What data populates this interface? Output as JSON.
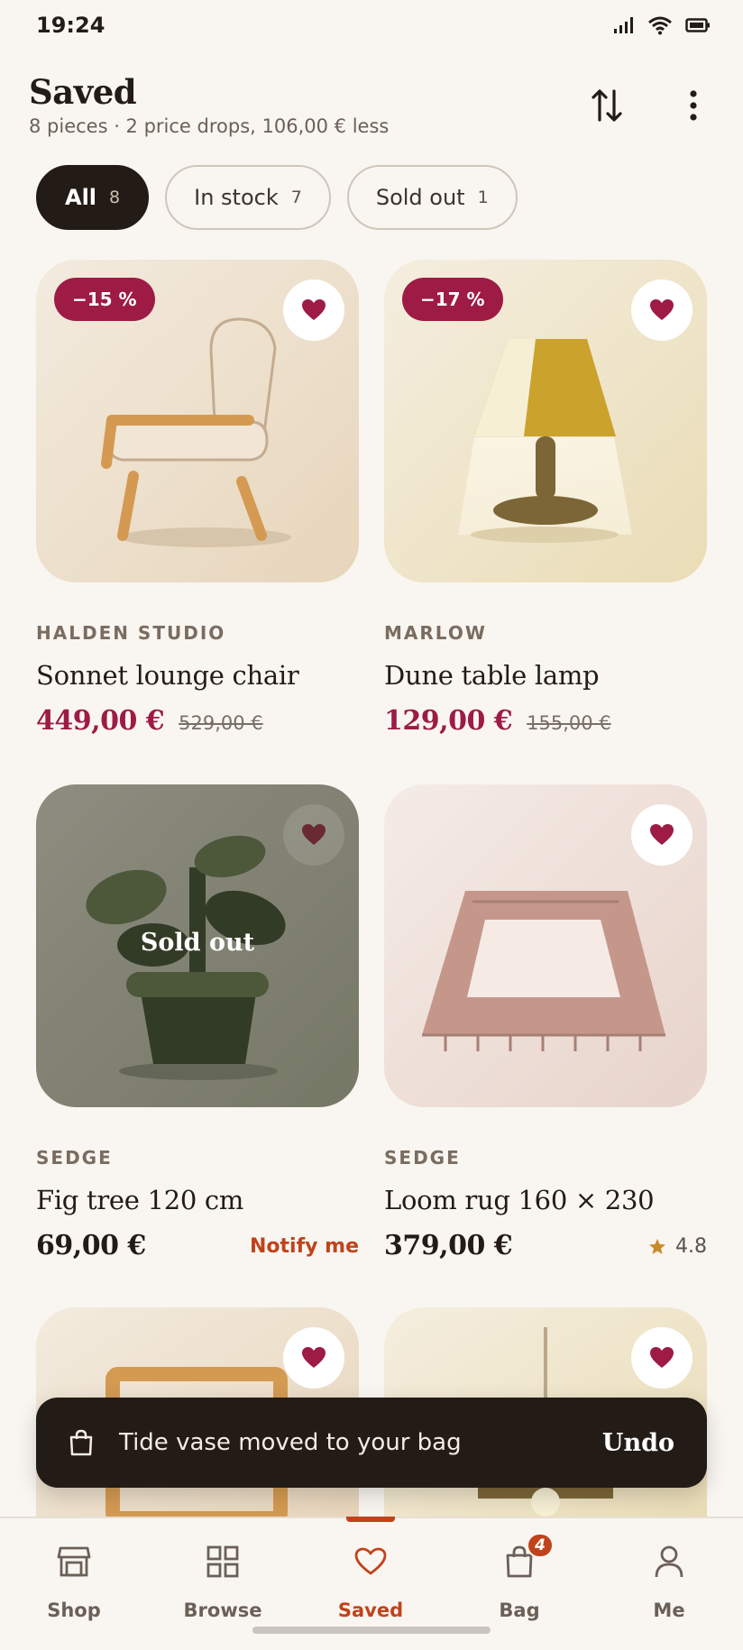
{
  "status": {
    "time": "19:24"
  },
  "header": {
    "title": "Saved",
    "subtitle": "8 pieces · 2 price drops, 106,00 € less"
  },
  "filters": [
    {
      "label": "All",
      "count": "8",
      "active": true
    },
    {
      "label": "In stock",
      "count": "7",
      "active": false
    },
    {
      "label": "Sold out",
      "count": "1",
      "active": false
    }
  ],
  "products": [
    {
      "brand": "HALDEN STUDIO",
      "name": "Sonnet lounge chair",
      "price": "449,00 €",
      "old_price": "529,00 €",
      "discount": "−15 %"
    },
    {
      "brand": "MARLOW",
      "name": "Dune table lamp",
      "price": "129,00 €",
      "old_price": "155,00 €",
      "discount": "−17 %"
    },
    {
      "brand": "SEDGE",
      "name": "Fig tree 120 cm",
      "price": "69,00 €",
      "sold_label": "Sold out",
      "action": "Notify me"
    },
    {
      "brand": "SEDGE",
      "name": "Loom rug 160 × 230",
      "price": "379,00 €",
      "rating": "4.8"
    }
  ],
  "toast": {
    "message": "Tide vase moved to your bag",
    "action": "Undo"
  },
  "nav": {
    "items": [
      {
        "label": "Shop",
        "icon": "store-icon"
      },
      {
        "label": "Browse",
        "icon": "grid-icon"
      },
      {
        "label": "Saved",
        "icon": "heart-icon",
        "active": true
      },
      {
        "label": "Bag",
        "icon": "bag-icon",
        "badge": "4"
      },
      {
        "label": "Me",
        "icon": "person-icon"
      }
    ]
  },
  "colors": {
    "accent": "#c1431b",
    "sale": "#9d1b45",
    "ink": "#231b16",
    "background": "#f9f6f1"
  }
}
